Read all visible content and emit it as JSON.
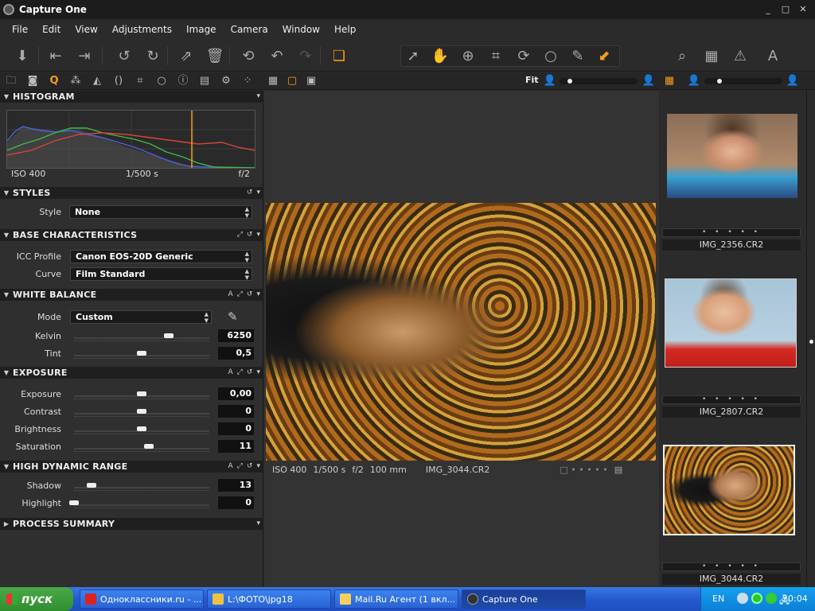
{
  "window": {
    "title": "Capture One",
    "min": "_",
    "max": "□",
    "close": "✕"
  },
  "menu": [
    "File",
    "Edit",
    "View",
    "Adjustments",
    "Image",
    "Camera",
    "Window",
    "Help"
  ],
  "toolbar": {
    "fit_label": "Fit",
    "accent_color": "#f39c1f"
  },
  "sections": {
    "histogram": {
      "title": "HISTOGRAM",
      "iso": "ISO 400",
      "shutter": "1/500 s",
      "aperture": "f/2"
    },
    "styles": {
      "title": "STYLES",
      "style_label": "Style",
      "style_value": "None"
    },
    "base": {
      "title": "BASE CHARACTERISTICS",
      "icc_label": "ICC Profile",
      "icc_value": "Canon EOS-20D Generic",
      "curve_label": "Curve",
      "curve_value": "Film Standard"
    },
    "wb": {
      "title": "WHITE BALANCE",
      "mode_label": "Mode",
      "mode_value": "Custom",
      "kelvin_label": "Kelvin",
      "kelvin_value": "6250",
      "kelvin_level": 0.7,
      "tint_label": "Tint",
      "tint_value": "0,5",
      "tint_level": 0.5
    },
    "exposure": {
      "title": "EXPOSURE",
      "rows": [
        {
          "label": "Exposure",
          "value": "0,00",
          "level": 0.5
        },
        {
          "label": "Contrast",
          "value": "0",
          "level": 0.5
        },
        {
          "label": "Brightness",
          "value": "0",
          "level": 0.5
        },
        {
          "label": "Saturation",
          "value": "11",
          "level": 0.55
        }
      ]
    },
    "hdr": {
      "title": "HIGH DYNAMIC RANGE",
      "rows": [
        {
          "label": "Shadow",
          "value": "13",
          "level": 0.13
        },
        {
          "label": "Highlight",
          "value": "0",
          "level": 0.0
        }
      ]
    },
    "process": {
      "title": "PROCESS SUMMARY"
    }
  },
  "viewer": {
    "iso": "ISO 400",
    "shutter": "1/500 s",
    "aperture": "f/2",
    "focal": "100 mm",
    "filename": "IMG_3044.CR2"
  },
  "thumbnails": [
    {
      "name": "IMG_2356.CR2",
      "stars": "• • • • •"
    },
    {
      "name": "IMG_2807.CR2",
      "stars": "• • • • •"
    },
    {
      "name": "IMG_3044.CR2",
      "stars": "• • • • •"
    }
  ],
  "taskbar": {
    "start": "пуск",
    "tasks": [
      "Одноклассники.ru - ...",
      "L:\\ФОТО\\jpg18",
      "Mail.Ru Агент (1 вкл...",
      "Capture One"
    ],
    "lang": "EN",
    "clock": "20:04"
  }
}
